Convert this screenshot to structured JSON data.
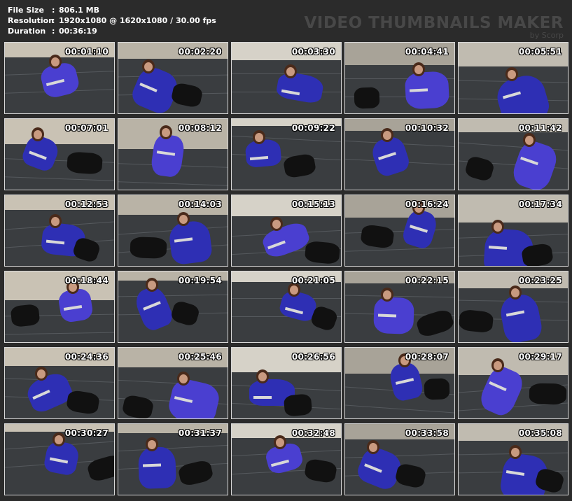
{
  "info": {
    "file_size_label": "File Size",
    "file_size_value": "806.1 MB",
    "resolution_label": "Resolution",
    "resolution_value": "1920x1080 @ 1620x1080 / 30.00 fps",
    "duration_label": "Duration",
    "duration_value": "00:36:19",
    "separator": ":"
  },
  "brand": {
    "title": "VIDEO THUMBNAILS MAKER",
    "subtitle": "by Scorp"
  },
  "thumbnails": [
    {
      "time": "00:01:10"
    },
    {
      "time": "00:02:20"
    },
    {
      "time": "00:03:30"
    },
    {
      "time": "00:04:41"
    },
    {
      "time": "00:05:51"
    },
    {
      "time": "00:07:01"
    },
    {
      "time": "00:08:12"
    },
    {
      "time": "00:09:22"
    },
    {
      "time": "00:10:32"
    },
    {
      "time": "00:11:42"
    },
    {
      "time": "00:12:53"
    },
    {
      "time": "00:14:03"
    },
    {
      "time": "00:15:13"
    },
    {
      "time": "00:16:24"
    },
    {
      "time": "00:17:34"
    },
    {
      "time": "00:18:44"
    },
    {
      "time": "00:19:54"
    },
    {
      "time": "00:21:05"
    },
    {
      "time": "00:22:15"
    },
    {
      "time": "00:23:25"
    },
    {
      "time": "00:24:36"
    },
    {
      "time": "00:25:46"
    },
    {
      "time": "00:26:56"
    },
    {
      "time": "00:28:07"
    },
    {
      "time": "00:29:17"
    },
    {
      "time": "00:30:27"
    },
    {
      "time": "00:31:37"
    },
    {
      "time": "00:32:48"
    },
    {
      "time": "00:33:58"
    },
    {
      "time": "00:35:08"
    }
  ]
}
